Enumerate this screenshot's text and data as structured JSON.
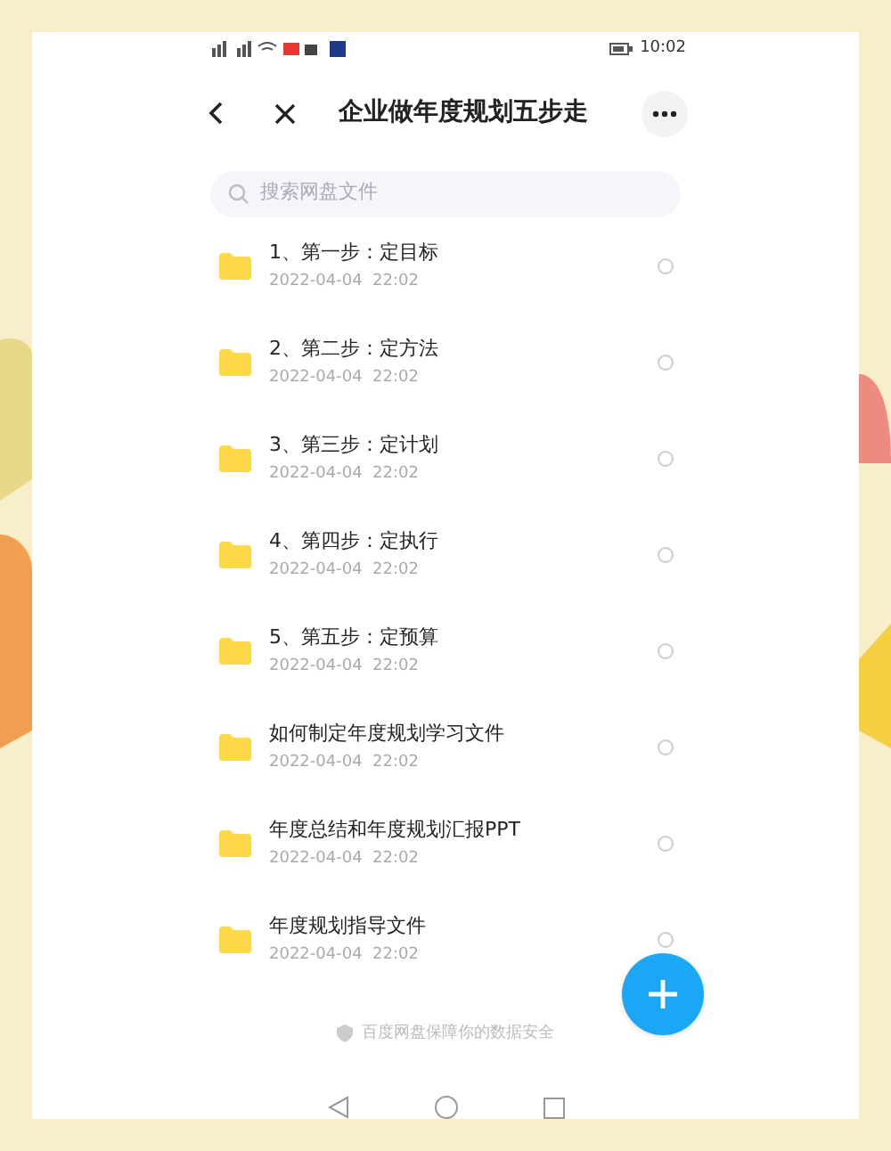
{
  "status_bar": {
    "time": "10:02"
  },
  "header": {
    "title": "企业做年度规划五步走"
  },
  "search": {
    "placeholder": "搜索网盘文件"
  },
  "files": [
    {
      "name": "1、第一步：定目标",
      "date": "2022-04-04  22:02",
      "selected": false
    },
    {
      "name": "2、第二步：定方法",
      "date": "2022-04-04  22:02",
      "selected": false
    },
    {
      "name": "3、第三步：定计划",
      "date": "2022-04-04  22:02",
      "selected": false
    },
    {
      "name": "4、第四步：定执行",
      "date": "2022-04-04  22:02",
      "selected": false
    },
    {
      "name": "5、第五步：定预算",
      "date": "2022-04-04  22:02",
      "selected": false
    },
    {
      "name": "如何制定年度规划学习文件",
      "date": "2022-04-04  22:02",
      "selected": false
    },
    {
      "name": "年度总结和年度规划汇报PPT",
      "date": "2022-04-04  22:02",
      "selected": false
    },
    {
      "name": "年度规划指导文件",
      "date": "2022-04-04  22:02",
      "selected": false
    }
  ],
  "footer": {
    "text": "百度网盘保障你的数据安全"
  }
}
